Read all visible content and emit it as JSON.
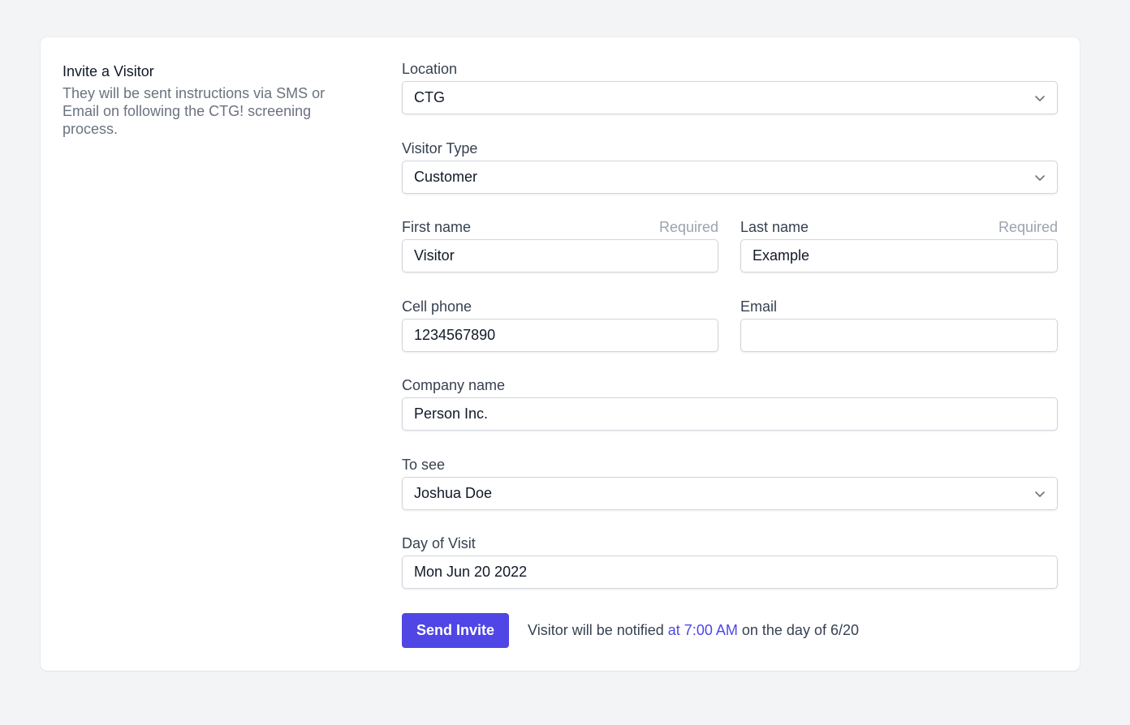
{
  "intro": {
    "title": "Invite a Visitor",
    "description": "They will be sent instructions via SMS or Email on following the CTG! screening process."
  },
  "form": {
    "location": {
      "label": "Location",
      "value": "CTG",
      "icon": "chevron-down-icon"
    },
    "visitor_type": {
      "label": "Visitor Type",
      "value": "Customer",
      "icon": "chevron-down-icon"
    },
    "first_name": {
      "label": "First name",
      "hint": "Required",
      "value": "Visitor"
    },
    "last_name": {
      "label": "Last name",
      "hint": "Required",
      "value": "Example"
    },
    "cell_phone": {
      "label": "Cell phone",
      "value": "1234567890"
    },
    "email": {
      "label": "Email",
      "value": ""
    },
    "company": {
      "label": "Company name",
      "value": "Person Inc."
    },
    "to_see": {
      "label": "To see",
      "value": "Joshua Doe",
      "icon": "chevron-down-icon"
    },
    "day_of_visit": {
      "label": "Day of Visit",
      "value": "Mon Jun 20 2022"
    }
  },
  "footer": {
    "send_label": "Send Invite",
    "note_prefix": "Visitor will be notified",
    "note_time": "at 7:00 AM",
    "note_suffix": "on the day of 6/20"
  },
  "colors": {
    "accent": "#4f46e5",
    "background": "#f3f4f6",
    "card": "#ffffff"
  }
}
